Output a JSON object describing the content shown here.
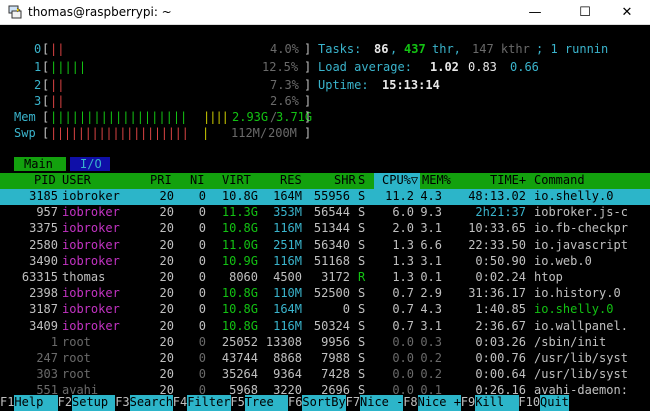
{
  "window": {
    "title": "thomas@raspberrypi: ~",
    "minimize": "—",
    "maximize": "☐",
    "close": "✕"
  },
  "meters": {
    "cpu": [
      {
        "label": "0",
        "bar": "||",
        "pct": "4.0%"
      },
      {
        "label": "1",
        "bar": "|||||",
        "pct": "12.5%"
      },
      {
        "label": "2",
        "bar": "||",
        "pct": "7.3%"
      },
      {
        "label": "3",
        "bar": "||",
        "pct": "2.6%"
      }
    ],
    "mem": {
      "label": "Mem",
      "bar": "|||||||||||||||||||",
      "used": "2.93G",
      "total": "3.71G"
    },
    "swp": {
      "label": "Swp",
      "bar": "||||||||||||||||||||",
      "used": "112M",
      "total": "200M"
    }
  },
  "summary": {
    "tasks_label": "Tasks:",
    "tasks": "86",
    "thr": "437",
    "thr_label": "thr,",
    "kthr": "147 kthr",
    "running_tail": "; 1 runnin",
    "load_label": "Load average:",
    "load1": "1.02",
    "load5": "0.83",
    "load15": "0.66",
    "uptime_label": "Uptime:",
    "uptime": "15:13:14"
  },
  "tabs": [
    "Main",
    "I/O"
  ],
  "columns": [
    "PID",
    "USER",
    "PRI",
    "NI",
    "VIRT",
    "RES",
    "SHR",
    "S",
    "CPU%",
    "MEM%",
    "TIME+",
    "Command"
  ],
  "sort_indicator": "▽",
  "processes": [
    {
      "pid": "3185",
      "user": "iobroker",
      "pri": "20",
      "ni": "0",
      "virt": "10.8G",
      "res": "164M",
      "shr": "55956",
      "s": "S",
      "cpu": "11.2",
      "mem": "4.3",
      "time": "48:13.02",
      "cmd": "io.shelly.0",
      "selected": true
    },
    {
      "pid": "957",
      "user": "iobroker",
      "pri": "20",
      "ni": "0",
      "virt": "11.3G",
      "res": "353M",
      "shr": "56544",
      "s": "S",
      "cpu": "6.0",
      "mem": "9.3",
      "time": "2h21:37",
      "cmd": "iobroker.js-c"
    },
    {
      "pid": "3375",
      "user": "iobroker",
      "pri": "20",
      "ni": "0",
      "virt": "10.8G",
      "res": "116M",
      "shr": "51344",
      "s": "S",
      "cpu": "2.0",
      "mem": "3.1",
      "time": "10:33.65",
      "cmd": "io.fb-checkpr"
    },
    {
      "pid": "2580",
      "user": "iobroker",
      "pri": "20",
      "ni": "0",
      "virt": "11.0G",
      "res": "251M",
      "shr": "56340",
      "s": "S",
      "cpu": "1.3",
      "mem": "6.6",
      "time": "22:33.50",
      "cmd": "io.javascript"
    },
    {
      "pid": "3490",
      "user": "iobroker",
      "pri": "20",
      "ni": "0",
      "virt": "10.9G",
      "res": "116M",
      "shr": "51168",
      "s": "S",
      "cpu": "1.3",
      "mem": "3.1",
      "time": "0:50.90",
      "cmd": "io.web.0"
    },
    {
      "pid": "63315",
      "user": "thomas",
      "pri": "20",
      "ni": "0",
      "virt": "8060",
      "res": "4500",
      "shr": "3172",
      "s": "R",
      "cpu": "1.3",
      "mem": "0.1",
      "time": "0:02.24",
      "cmd": "htop"
    },
    {
      "pid": "2398",
      "user": "iobroker",
      "pri": "20",
      "ni": "0",
      "virt": "10.8G",
      "res": "110M",
      "shr": "52500",
      "s": "S",
      "cpu": "0.7",
      "mem": "2.9",
      "time": "31:36.17",
      "cmd": "io.history.0"
    },
    {
      "pid": "3187",
      "user": "iobroker",
      "pri": "20",
      "ni": "0",
      "virt": "10.8G",
      "res": "164M",
      "shr": "0",
      "s": "S",
      "cpu": "0.7",
      "mem": "4.3",
      "time": "1:40.85",
      "cmd": "io.shelly.0"
    },
    {
      "pid": "3409",
      "user": "iobroker",
      "pri": "20",
      "ni": "0",
      "virt": "10.8G",
      "res": "116M",
      "shr": "50324",
      "s": "S",
      "cpu": "0.7",
      "mem": "3.1",
      "time": "2:36.67",
      "cmd": "io.wallpanel."
    },
    {
      "pid": "1",
      "user": "root",
      "pri": "20",
      "ni": "0",
      "virt": "25052",
      "res": "13308",
      "shr": "9956",
      "s": "S",
      "cpu": "0.0",
      "mem": "0.3",
      "time": "0:03.26",
      "cmd": "/sbin/init"
    },
    {
      "pid": "247",
      "user": "root",
      "pri": "20",
      "ni": "0",
      "virt": "43744",
      "res": "8868",
      "shr": "7988",
      "s": "S",
      "cpu": "0.0",
      "mem": "0.2",
      "time": "0:00.76",
      "cmd": "/usr/lib/syst"
    },
    {
      "pid": "303",
      "user": "root",
      "pri": "20",
      "ni": "0",
      "virt": "35264",
      "res": "9364",
      "shr": "7428",
      "s": "S",
      "cpu": "0.0",
      "mem": "0.2",
      "time": "0:00.64",
      "cmd": "/usr/lib/syst"
    },
    {
      "pid": "551",
      "user": "avahi",
      "pri": "20",
      "ni": "0",
      "virt": "5968",
      "res": "3220",
      "shr": "2696",
      "s": "S",
      "cpu": "0.0",
      "mem": "0.1",
      "time": "0:26.16",
      "cmd": "avahi-daemon:"
    }
  ],
  "fkeys": [
    {
      "key": "F1",
      "label": "Help  "
    },
    {
      "key": "F2",
      "label": "Setup "
    },
    {
      "key": "F3",
      "label": "Search"
    },
    {
      "key": "F4",
      "label": "Filter"
    },
    {
      "key": "F5",
      "label": "Tree  "
    },
    {
      "key": "F6",
      "label": "SortBy"
    },
    {
      "key": "F7",
      "label": "Nice -"
    },
    {
      "key": "F8",
      "label": "Nice +"
    },
    {
      "key": "F9",
      "label": "Kill  "
    },
    {
      "key": "F10",
      "label": "Quit"
    }
  ],
  "colors": {
    "header_bg": "#13a10e",
    "selected_bg": "#2cb5c9",
    "iobroker": "#c333c3",
    "cyan": "#3ab4cc"
  }
}
